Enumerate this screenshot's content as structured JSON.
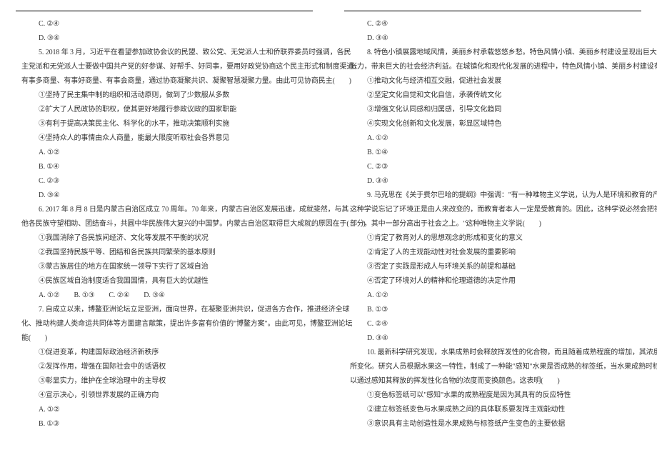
{
  "left": {
    "q4_optC": "C. ②④",
    "q4_optD": "D. ③④",
    "q5_text1": "5. 2018 年 3 月，习近平在看望参加政协会议的民盟、致公党、无党派人士和侨联界委员时强调，各民",
    "q5_text2": "主党派和无党派人士要做中国共产党的好参谋、好帮手、好同事，要用好政党协商这个民主形式和制度渠道，",
    "q5_text3": "有事多商量、有事好商量、有事会商量，通过协商凝聚共识、凝聚智慧凝聚力量。由此可见协商民主(　　)",
    "q5_opt1": "①坚持了民主集中制的组织和活动原则，做到了少数服从多数",
    "q5_opt2": "②扩大了人民政协的职权，使其更好地履行参政议政的国家职能",
    "q5_opt3": "③有利于提高决策民主化、科学化的水平，推动决策顺利实施",
    "q5_opt4": "④坚持众人的事情由众人商量，能最大限度听取社会各界意见",
    "q5_optA": "A. ①②",
    "q5_optB": "B. ①④",
    "q5_optC": "C. ②③",
    "q5_optD": "D. ③④",
    "q6_text1": "6. 2017 年 8 月 8 日是内蒙古自治区成立 70 周年。70 年来，内蒙古自治区发展迅速，成就斐然，与其",
    "q6_text2": "他各民族守望相助、团结奋斗，共圆中华民族伟大复兴的中国梦。内蒙古自治区取得巨大成就的原因在于(　　)",
    "q6_opt1": "①我国消除了各民族间经济、文化等发展不平衡的状况",
    "q6_opt2": "②我国坚持民族平等、团结和各民族共同繁荣的基本原则",
    "q6_opt3": "③蒙古族居住的地方在国家统一领导下实行了区域自治",
    "q6_opt4": "④民族区域自治制度适合我国国情，具有巨大的优越性",
    "q6_opts": "A. ①②　　B. ①③　　C. ②④　　D. ③④",
    "q7_text1": "7. 自成立以来，博鳌亚洲论坛立足亚洲，面向世界，在凝聚亚洲共识，促进各方合作，推进经济全球",
    "q7_text2": "化、推动构建人类命运共同体等方面建言献策，提出许多富有价值的\"博鳌方案\"。由此可见，博鳌亚洲论坛",
    "q7_text3": "能(　　)",
    "q7_opt1": "①促进变革，构建国际政治经济新秩序",
    "q7_opt2": "②发挥作用，增强在国际社会中的话语权",
    "q7_opt3": "③彰显实力，维护在全球治理中的主导权",
    "q7_opt4": "④宣示决心，引领世界发展的正确方向",
    "q7_optA": "A. ①②",
    "q7_optB": "B. ①③"
  },
  "right": {
    "q7_optC": "C. ②④",
    "q7_optD": "D. ③④",
    "q8_text1": "8. 特色小镇展露地域风情，美丽乡村承载悠悠乡愁。特色风情小镇、美丽乡村建设呈现出巨大的文化",
    "q8_text2": "张力，带来巨大的社会经济利益。在城镇化和现代化发展的进程中，特色风情小镇、美丽乡村建设有利于(　　)",
    "q8_opt1": "①推动文化与经济相互交融，促进社会发展",
    "q8_opt2": "②坚定文化自觉和文化自信，承袭传统文化",
    "q8_opt3": "③增强文化认同感和归属感，引导文化趋同",
    "q8_opt4": "④实现文化创新和文化发展，彰显区域特色",
    "q8_optA": "A. ①②",
    "q8_optB": "B. ①④",
    "q8_optC": "C. ②③",
    "q8_optD": "D. ③④",
    "q9_text1": "9. 马克思在《关于费尔巴哈的提纲》中强调：\"有一种唯物主义学说，认为人是环境和教育的产物，",
    "q9_text2": "这种学说忘记了环境正是由人来改变的，而教育者本人一定是受教育的。因此，这种学说必然会把社会分成两",
    "q9_text3": "部分，其中一部分高出于社会之上。\"这种唯物主义学说(　　)",
    "q9_opt1": "①肯定了教育对人的思想观念的形成和变化的意义",
    "q9_opt2": "②肯定了人的主观能动性对社会发展的重要影响",
    "q9_opt3": "③否定了实践是形成人与环境关系的前提和基础",
    "q9_opt4": "④否定了环境对人的精神和伦理道德的决定作用",
    "q9_optA": "A. ①②",
    "q9_optB": "B. ①③",
    "q9_optC": "C. ②④",
    "q9_optD": "D. ③④",
    "q10_text1": "10. 最新科学研究发现，水果成熟时会释放挥发性的化合物，而且随着成熟程度的增加，其浓度也会有",
    "q10_text2": "所变化。研究人员根据水果这一特性，制成了一种能\"感知\"水果是否成熟的标签纸，当水果成熟时标签纸可",
    "q10_text3": "以通过感知其释放的挥发性化合物的浓度而变换颜色。这表明(　　)",
    "q10_opt1": "①变色标签纸可以\"感知\"水果的成熟程度是因为其具有的反应特性",
    "q10_opt2": "②建立标签纸变色与水果成熟之间的具体联系要发挥主观能动性",
    "q10_opt3": "③意识具有主动创造性是水果成熟与标签纸产生变色的主要依据"
  }
}
